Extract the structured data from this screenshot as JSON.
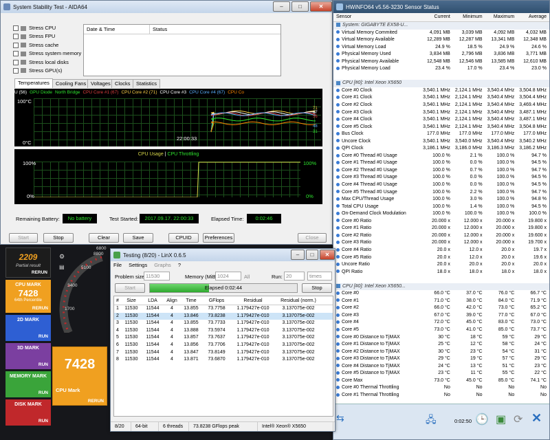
{
  "aida": {
    "title": "System Stability Test - AIDA64",
    "stress_options": [
      "Stress CPU",
      "Stress FPU",
      "Stress cache",
      "Stress system memory",
      "Stress local disks",
      "Stress GPU(s)"
    ],
    "log_headers": {
      "date": "Date & Time",
      "status": "Status"
    },
    "tabs": [
      "Temperatures",
      "Cooling Fans",
      "Voltages",
      "Clocks",
      "Statistics"
    ],
    "legend": [
      "U (56)",
      "GPU Diode",
      "North Bridge",
      "CPU Core #1 (67)",
      "CPU Core #2 (71)",
      "CPU Core #3",
      "CPU Core #4 (67)",
      "CPU Co"
    ],
    "temp_top": "100°C",
    "temp_bottom": "0°C",
    "temp_time": "22:00:33",
    "temp_readouts": [
      "71",
      "67",
      "56",
      "48",
      "31"
    ],
    "usage_title_a": "CPU Usage",
    "usage_sep": "|",
    "usage_title_b": "CPU Throttling",
    "usage_left_top": "100%",
    "usage_left_bottom": "0%",
    "usage_right_top": "100%",
    "usage_right_bottom": "0%",
    "remaining_battery_label": "Remaining Battery:",
    "remaining_battery_value": "No battery",
    "test_started_label": "Test Started:",
    "test_started_value": "2017.09.17. 22:00:33",
    "elapsed_label": "Elapsed Time:",
    "elapsed_value": "0:02:46",
    "buttons": {
      "start": "Start",
      "stop": "Stop",
      "clear": "Clear",
      "save": "Save",
      "cpuid": "CPUID",
      "preferences": "Preferences",
      "close": "Close"
    }
  },
  "bench": {
    "score_top": "2209",
    "score_top_sub": "Partial result",
    "rerun": "RERUN",
    "cpu_mark_label": "CPU MARK",
    "cpu_mark_value": "7428",
    "cpu_mark_pct": "64th Percentile",
    "mark2d": "2D MARK",
    "mark3d": "3D MARK",
    "memory": "MEMORY MARK",
    "disk": "DISK MARK",
    "run": "RUN",
    "big_value": "7428",
    "big_label": "CPU Mark",
    "gauge_labels": [
      "5100",
      "3400",
      "1700",
      "6800",
      "8800"
    ]
  },
  "linx": {
    "title": "Testing (8/20) - LinX 0.6.5",
    "menu": [
      "File",
      "Settings",
      "Graphs",
      "?"
    ],
    "problem_size_label": "Problem size:",
    "problem_size": "11530",
    "memory_label": "Memory (MiB):",
    "memory": "1024",
    "all_label": "All",
    "run_label": "Run:",
    "run_value": "20",
    "run_unit": "times",
    "start_btn": "Start",
    "stop_btn": "Stop",
    "elapsed": "Elapsed 0:02:44",
    "progress": 0.4,
    "headers": [
      "#",
      "Size",
      "LDA",
      "Align",
      "Time",
      "GFlops",
      "Residual",
      "Residual (norm.)"
    ],
    "rows": [
      [
        "1",
        "11530",
        "11544",
        "4",
        "13.855",
        "73.7758",
        "1.179427e-010",
        "3.137075e-002"
      ],
      [
        "2",
        "11530",
        "11544",
        "4",
        "13.846",
        "73.8238",
        "1.179427e-010",
        "3.137075e-002"
      ],
      [
        "3",
        "11530",
        "11544",
        "4",
        "13.855",
        "73.7733",
        "1.179427e-010",
        "3.137075e-002"
      ],
      [
        "4",
        "11530",
        "11544",
        "4",
        "13.888",
        "73.5974",
        "1.179427e-010",
        "3.137075e-002"
      ],
      [
        "5",
        "11530",
        "11544",
        "4",
        "13.857",
        "73.7637",
        "1.179427e-010",
        "3.137075e-002"
      ],
      [
        "6",
        "11530",
        "11544",
        "4",
        "13.856",
        "73.7706",
        "1.179427e-010",
        "3.137075e-002"
      ],
      [
        "7",
        "11530",
        "11544",
        "4",
        "13.847",
        "73.8149",
        "1.179427e-010",
        "3.137075e-002"
      ],
      [
        "8",
        "11530",
        "11544",
        "4",
        "13.871",
        "73.6870",
        "1.179427e-010",
        "3.137075e-002"
      ]
    ],
    "status": [
      "8/20",
      "64-bit",
      "6 threads",
      "73.8238 GFlops peak",
      "Intel® Xeon® X5650"
    ]
  },
  "hwinfo": {
    "title": "HWiNFO64 v5.56-3230 Sensor Status",
    "headers": [
      "Sensor",
      "Current",
      "Minimum",
      "Maximum",
      "Average"
    ],
    "rows": [
      {
        "s": "System: GIGABYTE EX58-U...",
        "sec": true
      },
      {
        "s": "Virtual Memory Commited",
        "v": [
          "4,091 MB",
          "3,039 MB",
          "4,092 MB",
          "4,032 MB"
        ]
      },
      {
        "s": "Virtual Memory Available",
        "v": [
          "12,289 MB",
          "12,287 MB",
          "13,341 MB",
          "12,348 MB"
        ]
      },
      {
        "s": "Virtual Memory Load",
        "v": [
          "24.9 %",
          "18.5 %",
          "24.9 %",
          "24.6 %"
        ]
      },
      {
        "s": "Physical Memory Used",
        "v": [
          "3,834 MB",
          "2,796 MB",
          "3,836 MB",
          "3,771 MB"
        ]
      },
      {
        "s": "Physical Memory Available",
        "v": [
          "12,548 MB",
          "12,546 MB",
          "13,585 MB",
          "12,610 MB"
        ]
      },
      {
        "s": "Physical Memory Load",
        "v": [
          "23.4 %",
          "17.0 %",
          "23.4 %",
          "23.0 %"
        ]
      },
      {
        "s": "",
        "blank": true
      },
      {
        "s": "CPU [#0]: Intel Xeon X5650",
        "sec": true
      },
      {
        "s": "Core #0 Clock",
        "v": [
          "3,540.1 MHz",
          "2,124.1 MHz",
          "3,540.4 MHz",
          "3,504.8 MHz"
        ]
      },
      {
        "s": "Core #1 Clock",
        "v": [
          "3,540.1 MHz",
          "2,124.1 MHz",
          "3,540.4 MHz",
          "3,504.4 MHz"
        ]
      },
      {
        "s": "Core #2 Clock",
        "v": [
          "3,540.1 MHz",
          "2,124.1 MHz",
          "3,540.4 MHz",
          "3,469.4 MHz"
        ]
      },
      {
        "s": "Core #3 Clock",
        "v": [
          "3,540.1 MHz",
          "2,124.1 MHz",
          "3,540.4 MHz",
          "3,487.1 MHz"
        ]
      },
      {
        "s": "Core #4 Clock",
        "v": [
          "3,540.1 MHz",
          "2,124.1 MHz",
          "3,540.4 MHz",
          "3,487.1 MHz"
        ]
      },
      {
        "s": "Core #5 Clock",
        "v": [
          "3,540.1 MHz",
          "2,124.1 MHz",
          "3,540.4 MHz",
          "3,504.8 MHz"
        ]
      },
      {
        "s": "Bus Clock",
        "v": [
          "177.0 MHz",
          "177.0 MHz",
          "177.0 MHz",
          "177.0 MHz"
        ]
      },
      {
        "s": "Uncore Clock",
        "v": [
          "3,540.1 MHz",
          "3,540.0 MHz",
          "3,540.4 MHz",
          "3,540.2 MHz"
        ]
      },
      {
        "s": "QPI Clock",
        "v": [
          "3,186.1 MHz",
          "3,186.0 MHz",
          "3,186.3 MHz",
          "3,186.2 MHz"
        ]
      },
      {
        "s": "Core #0 Thread #0 Usage",
        "v": [
          "100.0 %",
          "2.1 %",
          "100.0 %",
          "94.7 %"
        ]
      },
      {
        "s": "Core #1 Thread #0 Usage",
        "v": [
          "100.0 %",
          "0.0 %",
          "100.0 %",
          "94.5 %"
        ]
      },
      {
        "s": "Core #2 Thread #0 Usage",
        "v": [
          "100.0 %",
          "0.7 %",
          "100.0 %",
          "94.7 %"
        ]
      },
      {
        "s": "Core #3 Thread #0 Usage",
        "v": [
          "100.0 %",
          "0.0 %",
          "100.0 %",
          "94.5 %"
        ]
      },
      {
        "s": "Core #4 Thread #0 Usage",
        "v": [
          "100.0 %",
          "0.0 %",
          "100.0 %",
          "94.5 %"
        ]
      },
      {
        "s": "Core #5 Thread #0 Usage",
        "v": [
          "100.0 %",
          "2.2 %",
          "100.0 %",
          "94.7 %"
        ]
      },
      {
        "s": "Max CPU/Thread Usage",
        "v": [
          "100.0 %",
          "3.0 %",
          "100.0 %",
          "94.8 %"
        ]
      },
      {
        "s": "Total CPU Usage",
        "v": [
          "100.0 %",
          "1.4 %",
          "100.0 %",
          "94.5 %"
        ]
      },
      {
        "s": "On-Demand Clock Modulation",
        "v": [
          "100.0 %",
          "100.0 %",
          "100.0 %",
          "100.0 %"
        ]
      },
      {
        "s": "Core #0 Ratio",
        "v": [
          "20.000 x",
          "12.000 x",
          "20.000 x",
          "19.800 x"
        ]
      },
      {
        "s": "Core #1 Ratio",
        "v": [
          "20.000 x",
          "12.000 x",
          "20.000 x",
          "19.800 x"
        ]
      },
      {
        "s": "Core #2 Ratio",
        "v": [
          "20.000 x",
          "12.000 x",
          "20.000 x",
          "19.600 x"
        ]
      },
      {
        "s": "Core #3 Ratio",
        "v": [
          "20.000 x",
          "12.000 x",
          "20.000 x",
          "19.700 x"
        ]
      },
      {
        "s": "Core #4 Ratio",
        "v": [
          "20.0 x",
          "12.0 x",
          "20.0 x",
          "19.7 x"
        ]
      },
      {
        "s": "Core #5 Ratio",
        "v": [
          "20.0 x",
          "12.0 x",
          "20.0 x",
          "19.6 x"
        ]
      },
      {
        "s": "Uncore Ratio",
        "v": [
          "20.0 x",
          "20.0 x",
          "20.0 x",
          "20.0 x"
        ]
      },
      {
        "s": "QPI Ratio",
        "v": [
          "18.0 x",
          "18.0 x",
          "18.0 x",
          "18.0 x"
        ]
      },
      {
        "s": "",
        "blank": true
      },
      {
        "s": "CPU [#0]: Intel Xeon X5650...",
        "sec": true
      },
      {
        "s": "Core #0",
        "v": [
          "66.0 °C",
          "37.0 °C",
          "76.0 °C",
          "66.7 °C"
        ]
      },
      {
        "s": "Core #1",
        "v": [
          "71.0 °C",
          "38.0 °C",
          "84.0 °C",
          "71.9 °C"
        ]
      },
      {
        "s": "Core #2",
        "v": [
          "66.0 °C",
          "42.0 °C",
          "73.0 °C",
          "65.2 °C"
        ]
      },
      {
        "s": "Core #3",
        "v": [
          "67.0 °C",
          "39.0 °C",
          "77.0 °C",
          "67.0 °C"
        ]
      },
      {
        "s": "Core #4",
        "v": [
          "72.0 °C",
          "45.0 °C",
          "83.0 °C",
          "73.0 °C"
        ]
      },
      {
        "s": "Core #5",
        "v": [
          "73.0 °C",
          "41.0 °C",
          "85.0 °C",
          "73.7 °C"
        ]
      },
      {
        "s": "Core #0 Distance to TjMAX",
        "v": [
          "30 °C",
          "18 °C",
          "59 °C",
          "29 °C"
        ]
      },
      {
        "s": "Core #1 Distance to TjMAX",
        "v": [
          "25 °C",
          "12 °C",
          "58 °C",
          "24 °C"
        ]
      },
      {
        "s": "Core #2 Distance to TjMAX",
        "v": [
          "30 °C",
          "23 °C",
          "54 °C",
          "31 °C"
        ]
      },
      {
        "s": "Core #3 Distance to TjMAX",
        "v": [
          "29 °C",
          "19 °C",
          "57 °C",
          "29 °C"
        ]
      },
      {
        "s": "Core #4 Distance to TjMAX",
        "v": [
          "24 °C",
          "13 °C",
          "51 °C",
          "23 °C"
        ]
      },
      {
        "s": "Core #5 Distance to TjMAX",
        "v": [
          "23 °C",
          "11 °C",
          "55 °C",
          "22 °C"
        ]
      },
      {
        "s": "Core Max",
        "v": [
          "73.0 °C",
          "45.0 °C",
          "85.0 °C",
          "74.1 °C"
        ]
      },
      {
        "s": "Core #0 Thermal Throttling",
        "v": [
          "No",
          "No",
          "No",
          "No"
        ]
      },
      {
        "s": "Core #1 Thermal Throttling",
        "v": [
          "No",
          "No",
          "No",
          "No"
        ]
      }
    ],
    "timer": "0:02:50"
  },
  "colors": {
    "hw_titlebar": "#30506f",
    "accent_green": "#2fe62f",
    "linx_progress": "#3bbf3b"
  }
}
